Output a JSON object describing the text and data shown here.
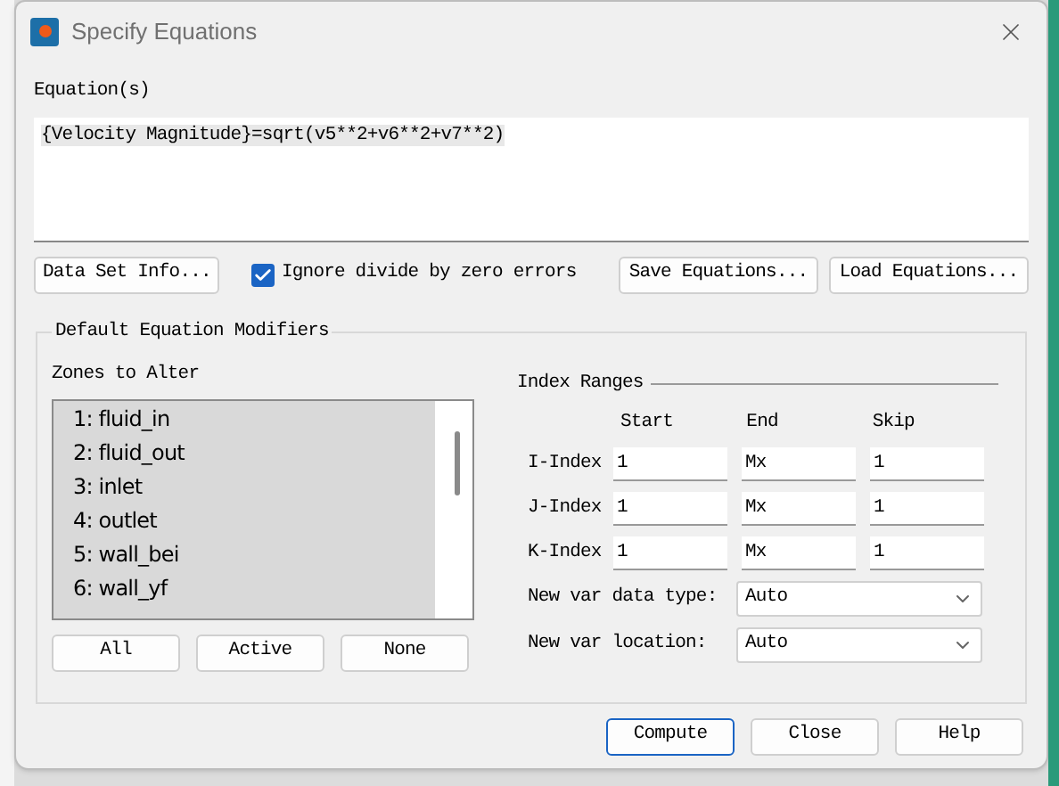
{
  "window": {
    "title": "Specify Equations"
  },
  "equations": {
    "label": "Equation(s)",
    "value": "{Velocity Magnitude}=sqrt(v5**2+v6**2+v7**2)"
  },
  "toolbar": {
    "data_set_info": "Data Set Info...",
    "ignore_divide": {
      "label": "Ignore divide by zero errors",
      "checked": true
    },
    "save": "Save Equations...",
    "load": "Load Equations..."
  },
  "modifiers": {
    "title": "Default Equation Modifiers",
    "zones": {
      "label": "Zones to Alter",
      "items": [
        {
          "label": "1: fluid_in",
          "selected": true
        },
        {
          "label": "2: fluid_out",
          "selected": true
        },
        {
          "label": "3: inlet",
          "selected": true
        },
        {
          "label": "4: outlet",
          "selected": true
        },
        {
          "label": "5: wall_bei",
          "selected": true
        },
        {
          "label": "6: wall_yf",
          "selected": true
        }
      ],
      "buttons": [
        "All",
        "Active",
        "None"
      ]
    },
    "index_ranges": {
      "title": "Index Ranges",
      "columns": [
        "Start",
        "End",
        "Skip"
      ],
      "rows": [
        {
          "label": "I-Index",
          "values": [
            "1",
            "Mx",
            "1"
          ]
        },
        {
          "label": "J-Index",
          "values": [
            "1",
            "Mx",
            "1"
          ]
        },
        {
          "label": "K-Index",
          "values": [
            "1",
            "Mx",
            "1"
          ]
        }
      ],
      "dropdowns": [
        {
          "label": "New var data type:",
          "value": "Auto"
        },
        {
          "label": "New var location:",
          "value": "Auto"
        }
      ]
    }
  },
  "buttons": [
    {
      "label": "Compute",
      "default": true
    },
    {
      "label": "Close",
      "default": false
    },
    {
      "label": "Help",
      "default": false
    }
  ]
}
